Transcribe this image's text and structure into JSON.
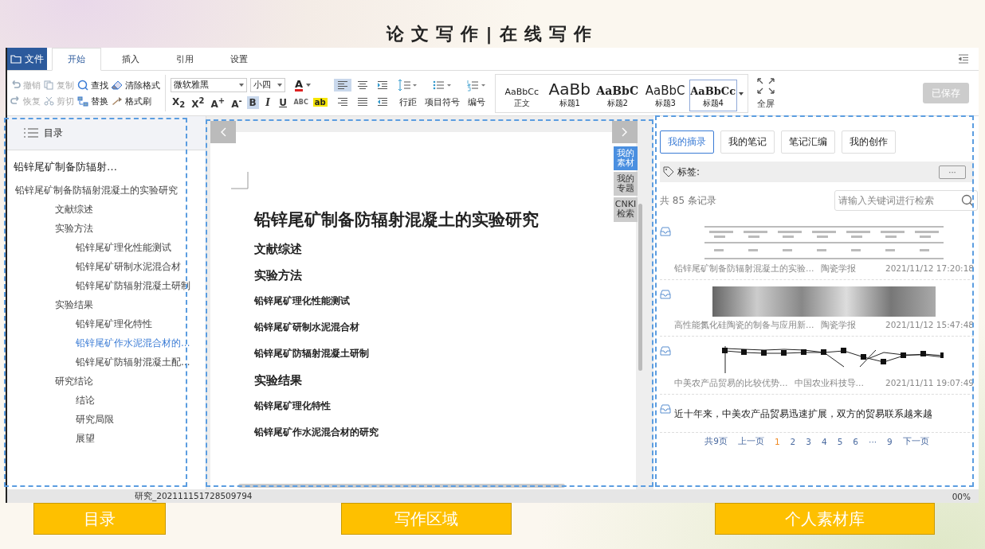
{
  "page_title": "论文写作|在线写作",
  "menu": {
    "file": "文件",
    "tabs": [
      {
        "label": "开始",
        "selected": true
      },
      {
        "label": "插入",
        "selected": false
      },
      {
        "label": "引用",
        "selected": false
      },
      {
        "label": "设置",
        "selected": false
      }
    ]
  },
  "ribbon": {
    "edit_actions": [
      {
        "label": "撤销",
        "kind": "undo",
        "disabled": true
      },
      {
        "label": "复制",
        "kind": "copy",
        "disabled": true
      },
      {
        "label": "查找",
        "kind": "find",
        "disabled": false
      },
      {
        "label": "清除格式",
        "kind": "eraser",
        "disabled": false
      },
      {
        "label": "恢复",
        "kind": "redo",
        "disabled": true
      },
      {
        "label": "剪切",
        "kind": "cut",
        "disabled": true
      },
      {
        "label": "替换",
        "kind": "replace",
        "disabled": false
      },
      {
        "label": "格式刷",
        "kind": "brush",
        "disabled": false
      }
    ],
    "font": "微软雅黑",
    "size": "小四",
    "font_color": "A",
    "highlight": "ab",
    "format_buttons": [
      {
        "label": "X$_{2}$",
        "kind": "sub",
        "selected": false
      },
      {
        "label": "X$^{2}$",
        "kind": "sup",
        "selected": false
      },
      {
        "label": "A$^{+}$",
        "kind": "grow",
        "selected": false
      },
      {
        "label": "A$^{-}$",
        "kind": "shrink",
        "selected": false
      },
      {
        "label": "B",
        "kind": "bold",
        "selected": true
      },
      {
        "label": "I",
        "kind": "italic",
        "selected": false
      },
      {
        "label": "U",
        "kind": "underline",
        "selected": false
      },
      {
        "label": "ABC",
        "kind": "strike",
        "selected": false
      }
    ],
    "paragraph_tools": [
      {
        "kind": "align-left",
        "selected": true
      },
      {
        "kind": "align-center",
        "selected": false
      },
      {
        "kind": "indent",
        "selected": false
      },
      {
        "kind": "align-right",
        "selected": false
      },
      {
        "kind": "justify",
        "selected": false
      },
      {
        "kind": "outdent",
        "selected": false
      }
    ],
    "list_tools": [
      {
        "label": "行距",
        "kind": "spacing"
      },
      {
        "label": "项目符号",
        "kind": "bullets"
      },
      {
        "label": "编号",
        "kind": "numbering"
      }
    ],
    "styles": [
      {
        "sample": "AaBbCc",
        "label": "正文",
        "kind": "normal",
        "selected": false
      },
      {
        "sample": "AaBb",
        "label": "标题1",
        "kind": "h1",
        "selected": false
      },
      {
        "sample": "AaBbC",
        "label": "标题2",
        "kind": "h2",
        "selected": false
      },
      {
        "sample": "AaBbC",
        "label": "标题3",
        "kind": "h3",
        "selected": false
      },
      {
        "sample": "AaBbCc",
        "label": "标题4",
        "kind": "h4",
        "selected": true
      }
    ],
    "fullscreen": "全屏",
    "saved": {
      "label": "已保存",
      "disabled": true
    }
  },
  "toc": {
    "title": "目录",
    "doc_title": "铅锌尾矿制备防辐射…",
    "items": [
      {
        "label": "铅锌尾矿制备防辐射混凝土的实验研究",
        "selected": false,
        "children": [
          {
            "label": "文献综述",
            "selected": false
          },
          {
            "label": "实验方法",
            "selected": false,
            "children": [
              {
                "label": "铅锌尾矿理化性能测试",
                "selected": false
              },
              {
                "label": "铅锌尾矿研制水泥混合材",
                "selected": false
              },
              {
                "label": "铅锌尾矿防辐射混凝土研制",
                "selected": false
              }
            ]
          },
          {
            "label": "实验结果",
            "selected": false,
            "children": [
              {
                "label": "铅锌尾矿理化特性",
                "selected": false
              },
              {
                "label": "铅锌尾矿作水泥混合材的…",
                "selected": true
              },
              {
                "label": "铅锌尾矿防辐射混凝土配…",
                "selected": false
              }
            ]
          },
          {
            "label": "研究结论",
            "selected": false,
            "children": [
              {
                "label": "结论",
                "selected": false
              },
              {
                "label": "研究局限",
                "selected": false
              },
              {
                "label": "展望",
                "selected": false
              }
            ]
          }
        ]
      }
    ]
  },
  "document": {
    "side_tabs": [
      {
        "label": "我的素材",
        "selected": true
      },
      {
        "label": "我的专题",
        "selected": false
      },
      {
        "label": "CNKI检索",
        "selected": false
      }
    ],
    "blocks": [
      {
        "kind": "title",
        "text": "铅锌尾矿制备防辐射混凝土的实验研究"
      },
      {
        "kind": "h2",
        "text": "文献综述"
      },
      {
        "kind": "h2",
        "text": "实验方法"
      },
      {
        "kind": "h3",
        "text": "铅锌尾矿理化性能测试"
      },
      {
        "kind": "h3",
        "text": "铅锌尾矿研制水泥混合材"
      },
      {
        "kind": "h3",
        "text": "铅锌尾矿防辐射混凝土研制"
      },
      {
        "kind": "h2",
        "text": "实验结果"
      },
      {
        "kind": "h3",
        "text": "铅锌尾矿理化特性"
      },
      {
        "kind": "h3",
        "text": "铅锌尾矿作水泥混合材的研究"
      }
    ]
  },
  "library": {
    "tabs": [
      {
        "label": "我的摘录",
        "selected": true
      },
      {
        "label": "我的笔记",
        "selected": false
      },
      {
        "label": "笔记汇编",
        "selected": false
      },
      {
        "label": "我的创作",
        "selected": false
      }
    ],
    "tag_label": "标签:",
    "more": "···",
    "count": "共 85 条记录",
    "search_placeholder": "请输入关键词进行检索",
    "entries": [
      {
        "kind": "table",
        "title": "铅锌尾矿制备防辐射混凝土的实验…",
        "source": "陶瓷学报",
        "date": "2021/11/12 17:20:18"
      },
      {
        "kind": "photo",
        "title": "高性能氮化硅陶瓷的制备与应用新…",
        "source": "陶瓷学报",
        "date": "2021/11/12 15:47:48"
      },
      {
        "kind": "chart",
        "title": "中美农产品贸易的比较优势…",
        "source": "中国农业科技导…",
        "date": "2021/11/11 19:07:49"
      },
      {
        "kind": "text",
        "excerpt": "近十年来，中美农产品贸易迅速扩展，双方的贸易联系越来越"
      }
    ],
    "pager": {
      "total": "共9页",
      "prev": "上一页",
      "pages": [
        {
          "label": "1",
          "selected": true
        },
        {
          "label": "2",
          "selected": false
        },
        {
          "label": "3",
          "selected": false
        },
        {
          "label": "4",
          "selected": false
        },
        {
          "label": "5",
          "selected": false
        },
        {
          "label": "6",
          "selected": false
        },
        {
          "label": "···",
          "selected": false
        },
        {
          "label": "9",
          "selected": false
        }
      ],
      "next": "下一页"
    }
  },
  "status": {
    "file": "研究_202111151728509794",
    "zoom": "00%"
  },
  "annotations": [
    {
      "label": "目录"
    },
    {
      "label": "写作区域"
    },
    {
      "label": "个人素材库"
    }
  ]
}
